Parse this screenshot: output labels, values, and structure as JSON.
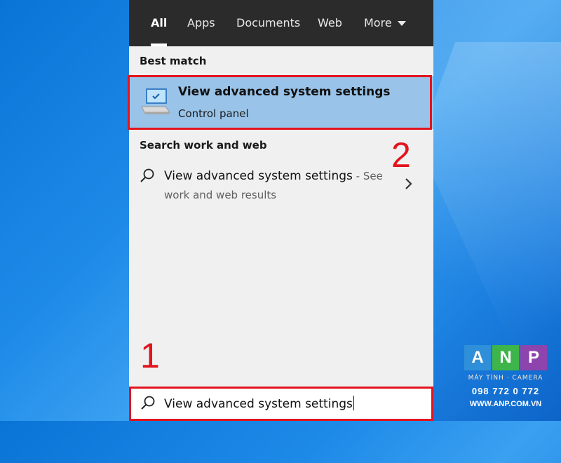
{
  "tabs": [
    {
      "label": "All",
      "active": true
    },
    {
      "label": "Apps",
      "active": false
    },
    {
      "label": "Documents",
      "active": false
    },
    {
      "label": "Web",
      "active": false
    },
    {
      "label": "More",
      "active": false
    }
  ],
  "best_match": {
    "heading": "Best match",
    "title": "View advanced system settings",
    "subtitle": "Control panel",
    "icon": "control-panel-icon"
  },
  "web_section": {
    "heading": "Search work and web",
    "query": "View advanced system settings",
    "suffix": " - See",
    "line2": "work and web results"
  },
  "search_box": {
    "value": "View advanced system settings"
  },
  "annotations": {
    "step1": "1",
    "step2": "2",
    "color": "#e3141d"
  },
  "watermark": {
    "letters": [
      "A",
      "N",
      "P"
    ],
    "colors": [
      "#2f8fd8",
      "#3db54a",
      "#8e44ad"
    ],
    "tagline": "MÁY TÍNH · CAMERA",
    "phone": "098 772 0 772",
    "url": "WWW.ANP.COM.VN"
  }
}
